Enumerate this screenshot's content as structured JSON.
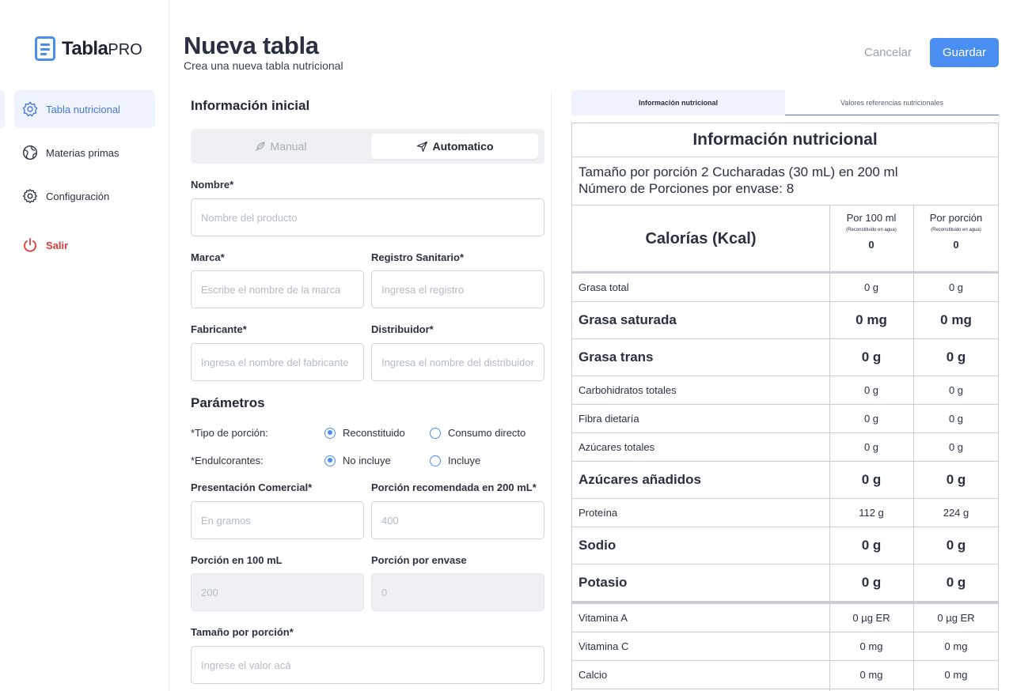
{
  "app": {
    "logo_text": "Tabla",
    "logo_suffix": "PRO"
  },
  "sidebar": {
    "items": [
      {
        "label": "Tabla nutricional",
        "icon": "hexagon-nut-icon",
        "active": true
      },
      {
        "label": "Materias primas",
        "icon": "globe-icon",
        "active": false
      },
      {
        "label": "Configuración",
        "icon": "gear-icon",
        "active": false
      }
    ],
    "logout_label": "Salir"
  },
  "header": {
    "title": "Nueva tabla",
    "subtitle": "Crea una nueva tabla nutricional",
    "cancel_label": "Cancelar",
    "save_label": "Guardar"
  },
  "form": {
    "section_initial": "Información inicial",
    "mode_manual": "Manual",
    "mode_auto": "Automatico",
    "nombre": {
      "label": "Nombre*",
      "placeholder": "Nombre del producto"
    },
    "marca": {
      "label": "Marca*",
      "placeholder": "Escribe el nombre de la marca"
    },
    "registro": {
      "label": "Registro Sanitario*",
      "placeholder": "Ingresa el registro"
    },
    "fabricante": {
      "label": "Fabricante*",
      "placeholder": "Ingresa el nombre del fabricante"
    },
    "distribuidor": {
      "label": "Distribuidor*",
      "placeholder": "Ingresa el nombre del distribuidor"
    },
    "section_params": "Parámetros",
    "tipo_porcion": {
      "label": "*Tipo de porción:",
      "opt1": "Reconstituido",
      "opt2": "Consumo directo",
      "selected": "Reconstituido"
    },
    "endulcorantes": {
      "label": "*Endulcorantes:",
      "opt1": "No incluye",
      "opt2": "Incluye",
      "selected": "No incluye"
    },
    "presentacion": {
      "label": "Presentación Comercial*",
      "placeholder": "En gramos"
    },
    "porcion_recomendada": {
      "label": "Porción recomendada en 200 mL*",
      "placeholder": "400"
    },
    "porcion_100": {
      "label": "Porción en 100 mL",
      "placeholder": "200"
    },
    "porcion_envase": {
      "label": "Porción por envase",
      "placeholder": "0"
    },
    "tamano_porcion": {
      "label": "Tamaño por porción*",
      "placeholder": "Ingrese el valor acá"
    }
  },
  "nutrition": {
    "tab_info": "Información nutricional",
    "tab_ref": "Valores referencias nutricionales",
    "title": "Información nutricional",
    "serving_line1": "Tamaño por porción 2 Cucharadas  (30 mL) en 200 ml",
    "serving_line2": "Número de  Porciones por envase: 8",
    "calories_label": "Calorías (Kcal)",
    "col1_head": "Por 100 ml",
    "col1_sub": "(Reconstituido en agua)",
    "col1_cal": "0",
    "col2_head": "Por porción",
    "col2_sub": "(Reconstituido en agua)",
    "col2_cal": "0",
    "rows": [
      {
        "name": "Grasa total",
        "per100": "0 g",
        "perServing": "0 g"
      },
      {
        "name": "Grasa saturada",
        "per100": "0 mg",
        "perServing": "0 mg"
      },
      {
        "name": "Grasa trans",
        "per100": "0 g",
        "perServing": "0 g"
      },
      {
        "name": "Carbohidratos totales",
        "per100": "0 g",
        "perServing": "0 g"
      },
      {
        "name": "Fibra dietaría",
        "per100": "0 g",
        "perServing": "0 g"
      },
      {
        "name": "Azúcares totales",
        "per100": "0 g",
        "perServing": "0 g"
      },
      {
        "name": "Azúcares añadidos",
        "per100": "0 g",
        "perServing": "0 g"
      },
      {
        "name": "Proteína",
        "per100": "112 g",
        "perServing": "224 g"
      },
      {
        "name": "Sodio",
        "per100": "0 g",
        "perServing": "0 g"
      },
      {
        "name": "Potasio",
        "per100": "0 g",
        "perServing": "0 g"
      },
      {
        "name": "Vitamina A",
        "per100": "0 µg ER",
        "perServing": "0 µg ER"
      },
      {
        "name": "Vitamina C",
        "per100": "0 mg",
        "perServing": "0 mg"
      },
      {
        "name": "Calcio",
        "per100": "0 mg",
        "perServing": "0 mg"
      }
    ]
  },
  "colors": {
    "accent": "#4a8ef2",
    "active_nav_bg": "#eef3fd",
    "logout": "#e03b3b"
  }
}
